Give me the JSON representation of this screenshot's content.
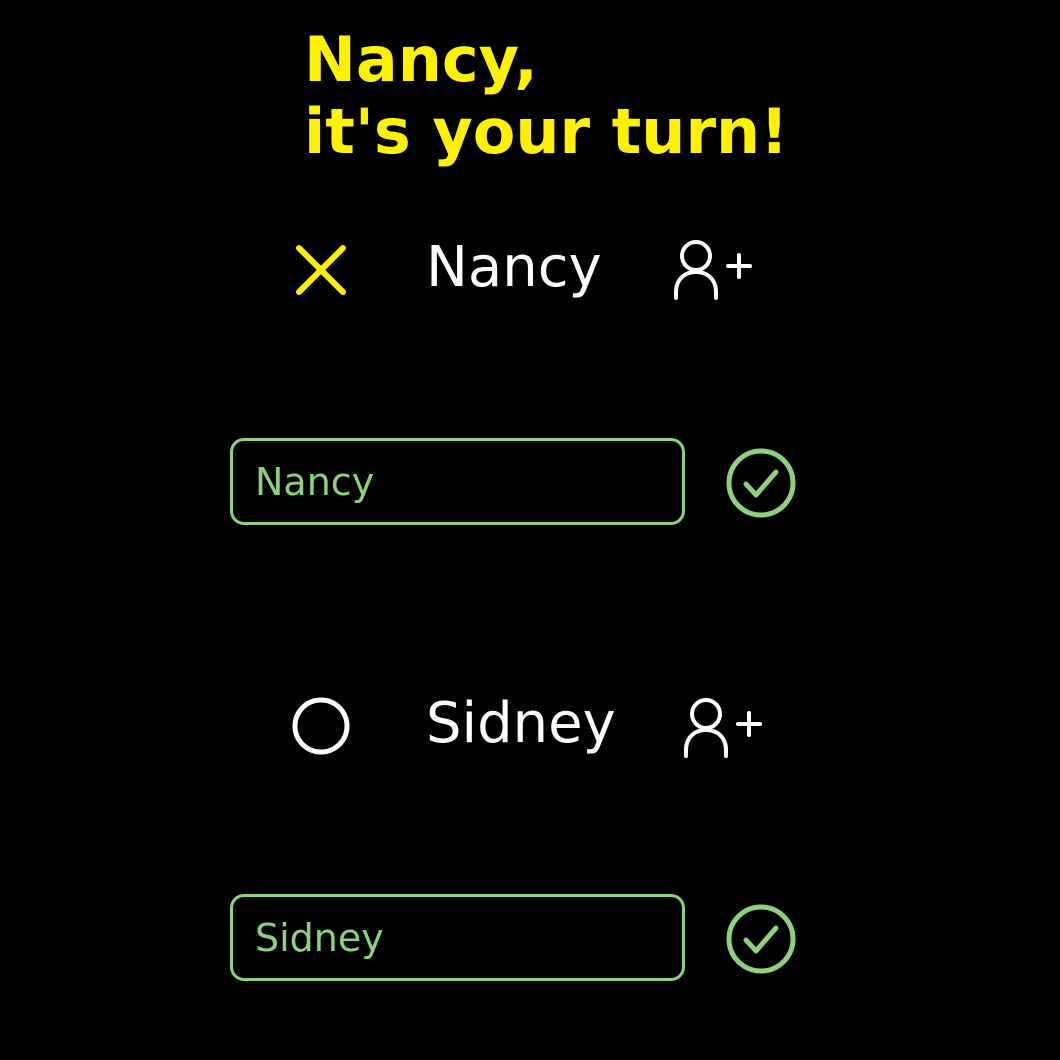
{
  "heading": {
    "line1": "Nancy,",
    "line2": "it's your turn!"
  },
  "players": [
    {
      "name": "Nancy",
      "marker": "x-icon",
      "marker_color": "#FFF200",
      "input_value": "Nancy",
      "add_icon": "add-user-icon",
      "confirm_icon": "check-circle-icon"
    },
    {
      "name": "Sidney",
      "marker": "circle-o-icon",
      "marker_color": "#FFFFFF",
      "input_value": "Sidney",
      "add_icon": "add-user-icon",
      "confirm_icon": "check-circle-icon"
    }
  ],
  "colors": {
    "background": "#000000",
    "accent_yellow": "#FFF200",
    "text_white": "#FFFFFF",
    "field_green": "#8ED07E"
  }
}
